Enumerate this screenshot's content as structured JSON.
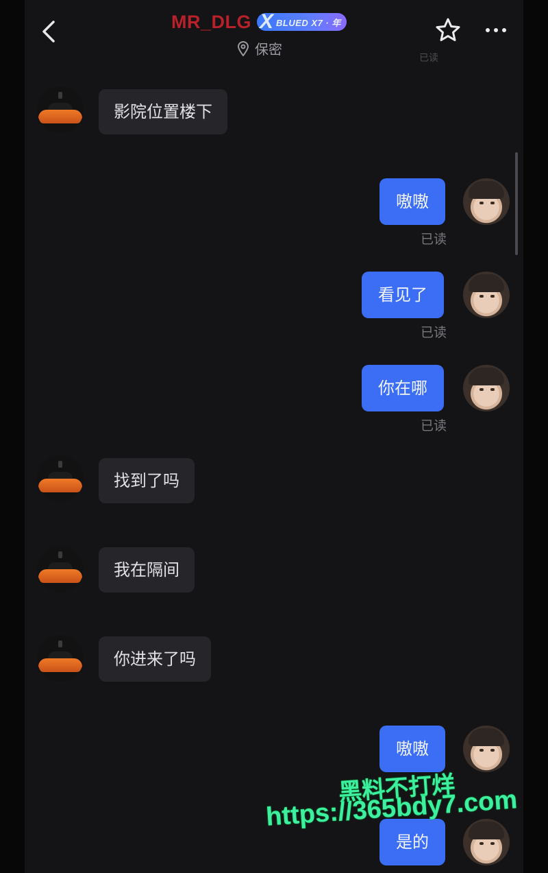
{
  "header": {
    "username": "MR_DLG",
    "vip_badge": "BLUED X7 · 年",
    "vip_x": "X",
    "location": "保密",
    "faded_top": "已读",
    "back_icon": "chevron-left-icon",
    "star_icon": "star-icon",
    "more_icon": "more-dots-icon"
  },
  "messages": [
    {
      "dir": "in",
      "text": "影院位置楼下"
    },
    {
      "dir": "out",
      "text": "嗷嗷",
      "status": "已读"
    },
    {
      "dir": "out",
      "text": "看见了",
      "status": "已读"
    },
    {
      "dir": "out",
      "text": "你在哪",
      "status": "已读"
    },
    {
      "dir": "in",
      "text": "找到了吗"
    },
    {
      "dir": "in",
      "text": "我在隔间"
    },
    {
      "dir": "in",
      "text": "你进来了吗"
    },
    {
      "dir": "out",
      "text": "嗷嗷"
    },
    {
      "dir": "out",
      "text": "是的"
    }
  ],
  "watermark": {
    "line1": "黑料不打烊",
    "line2": "https://365bdy7.com"
  },
  "colors": {
    "background": "#141416",
    "outgoing_bubble": "#3b6ef5",
    "incoming_bubble": "#26262a",
    "username": "#b8202a",
    "watermark": "#3cf0a0"
  }
}
